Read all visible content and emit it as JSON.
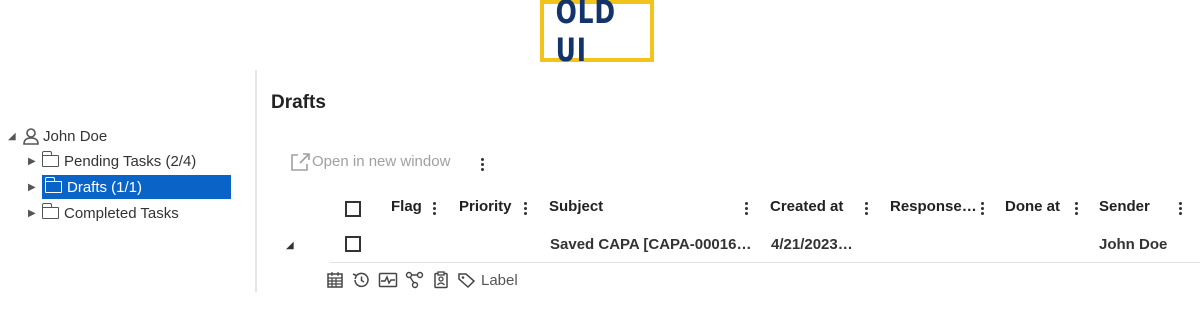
{
  "badge": {
    "text": "OLD UI"
  },
  "tree": {
    "root": {
      "label": "John Doe"
    },
    "items": [
      {
        "label": "Pending Tasks (2/4)"
      },
      {
        "label": "Drafts (1/1)"
      },
      {
        "label": "Completed Tasks"
      }
    ]
  },
  "page": {
    "title": "Drafts"
  },
  "toolbar": {
    "open_new_window": "Open in new window"
  },
  "table": {
    "columns": [
      "Flag",
      "Priority",
      "Subject",
      "Created at",
      "Response…",
      "Done at",
      "Sender"
    ],
    "rows": [
      {
        "flag": "",
        "priority": "",
        "subject": "Saved CAPA [CAPA-00016…",
        "created_at": "4/21/2023…",
        "response": "",
        "done_at": "",
        "sender": "John Doe"
      }
    ]
  },
  "row_actions": {
    "label": "Label"
  },
  "colors": {
    "selected": "#0a64c8",
    "badge_border": "#f2c31b",
    "badge_text": "#12346b"
  }
}
